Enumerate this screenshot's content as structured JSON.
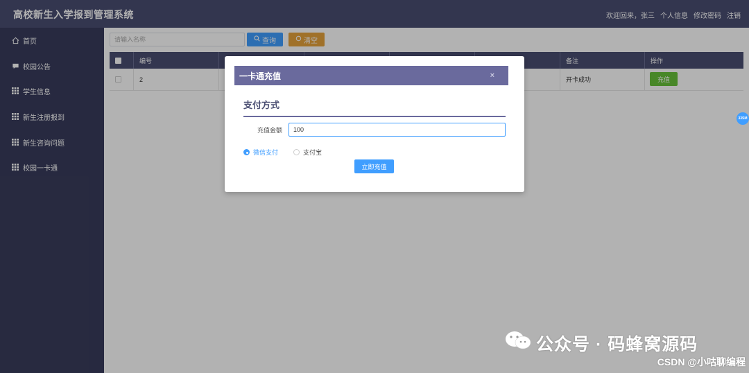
{
  "app": {
    "title": "高校新生入学报到管理系统",
    "welcome": "欢迎回来，张三",
    "profile": "个人信息",
    "change_password": "修改密码",
    "logout": "注销"
  },
  "sidebar": {
    "items": [
      {
        "label": "首页",
        "icon": "home-icon"
      },
      {
        "label": "校园公告",
        "icon": "comment-icon"
      },
      {
        "label": "学生信息",
        "icon": "grid-icon"
      },
      {
        "label": "新生注册报到",
        "icon": "grid-icon"
      },
      {
        "label": "新生咨询问题",
        "icon": "grid-icon"
      },
      {
        "label": "校园一卡通",
        "icon": "grid-icon"
      }
    ]
  },
  "toolbar": {
    "search_placeholder": "请输入名称",
    "query_label": "查询",
    "clear_label": "清空"
  },
  "table": {
    "headers": {
      "id": "编号",
      "remark": "备注",
      "action": "操作"
    },
    "rows": [
      {
        "id": "2",
        "remark": "开卡成功",
        "action": "充值"
      }
    ]
  },
  "float_badge": "33SM",
  "modal": {
    "title": "一卡通充值",
    "close": "×",
    "subtitle": "支付方式",
    "amount_label": "充值金额",
    "amount_value": "100",
    "payment_options": [
      {
        "label": "微信支付",
        "selected": true
      },
      {
        "label": "支付宝",
        "selected": false
      }
    ],
    "submit_label": "立即充值"
  },
  "watermark": {
    "line1": "公众号 · 码蜂窝源码",
    "line2": "CSDN @小咕聊编程"
  },
  "colors": {
    "header": "#4a4e72",
    "sidebar": "#393c5c",
    "primary": "#409eff",
    "warning": "#e6a23c",
    "success": "#67c23a",
    "modal_header": "#6a6a9d"
  }
}
